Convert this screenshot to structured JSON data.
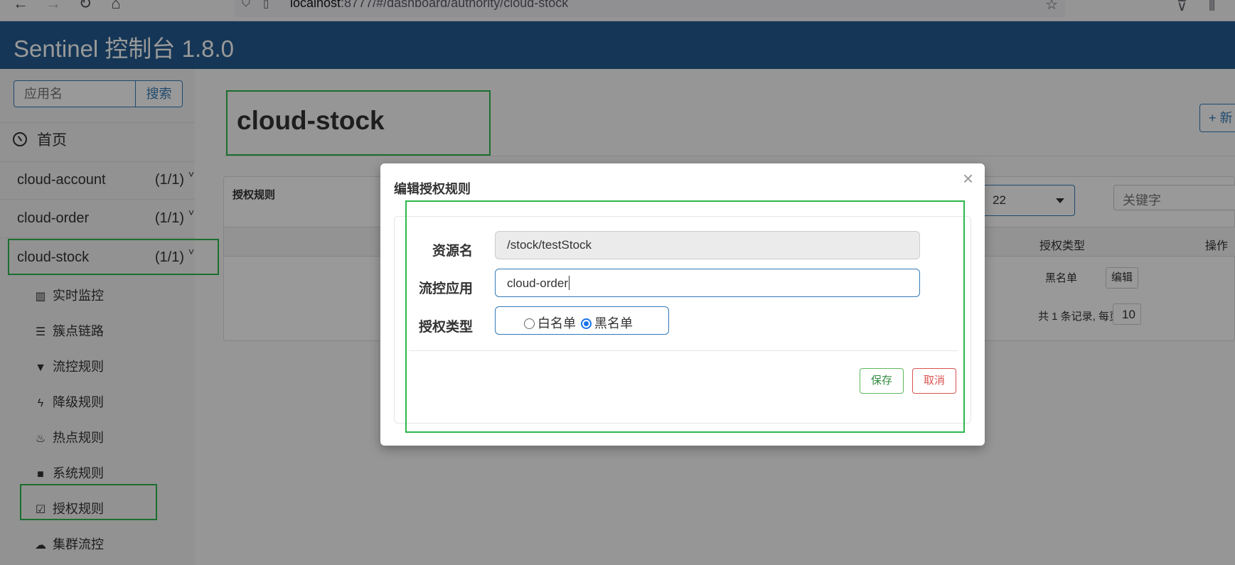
{
  "browser": {
    "url_host": "localhost",
    "url_rest": ":8777/#/dashboard/authority/cloud-stock"
  },
  "header": {
    "brand": "Sentinel 控制台 1.8.0"
  },
  "sidebar": {
    "search_placeholder": "应用名",
    "search_button": "搜索",
    "home_label": "首页",
    "apps": [
      {
        "name": "cloud-account",
        "count": "(1/1)"
      },
      {
        "name": "cloud-order",
        "count": "(1/1)"
      },
      {
        "name": "cloud-stock",
        "count": "(1/1)"
      }
    ],
    "menu": [
      {
        "label": "实时监控",
        "icon": "bar-chart-icon"
      },
      {
        "label": "簇点链路",
        "icon": "list-icon"
      },
      {
        "label": "流控规则",
        "icon": "filter-icon"
      },
      {
        "label": "降级规则",
        "icon": "flash-icon"
      },
      {
        "label": "热点规则",
        "icon": "fire-icon"
      },
      {
        "label": "系统规则",
        "icon": "lock-icon"
      },
      {
        "label": "授权规则",
        "icon": "check-square-icon"
      },
      {
        "label": "集群流控",
        "icon": "cloud-icon"
      }
    ]
  },
  "main": {
    "page_title": "cloud-stock",
    "add_button": "+ 新",
    "panel_title": "授权规则",
    "app_select_value": "22",
    "keyword_placeholder": "关键字",
    "columns": {
      "auth_type": "授权类型",
      "ops": "操作"
    },
    "row": {
      "auth_type": "黑名单",
      "edit": "编辑"
    },
    "pager_text": "共 1 条记录, 每页",
    "page_size": "10"
  },
  "modal": {
    "title": "编辑授权规则",
    "close": "×",
    "resource_label": "资源名",
    "resource_value": "/stock/testStock",
    "limit_app_label": "流控应用",
    "limit_app_value": "cloud-order",
    "auth_type_label": "授权类型",
    "whitelist": "白名单",
    "blacklist": "黑名单",
    "selected": "黑名单",
    "save": "保存",
    "cancel": "取消"
  }
}
